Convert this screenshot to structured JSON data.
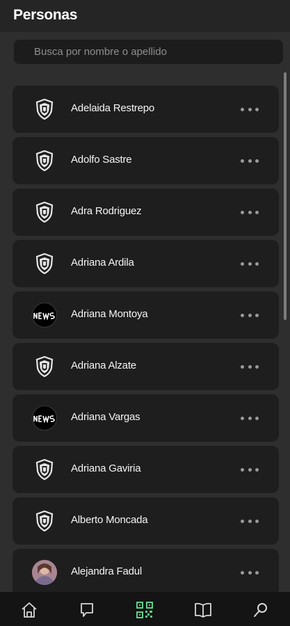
{
  "header": {
    "title": "Personas"
  },
  "search": {
    "placeholder": "Busca por nombre o apellido"
  },
  "people": [
    {
      "name": "Adelaida Restrepo",
      "avatar": "shield-logo"
    },
    {
      "name": "Adolfo Sastre",
      "avatar": "shield-logo"
    },
    {
      "name": "Adra Rodriguez",
      "avatar": "shield-logo"
    },
    {
      "name": "Adriana Ardila",
      "avatar": "shield-logo"
    },
    {
      "name": "Adriana Montoya",
      "avatar": "news-logo"
    },
    {
      "name": "Adriana Alzate",
      "avatar": "shield-logo"
    },
    {
      "name": "Adriana Vargas",
      "avatar": "news-logo"
    },
    {
      "name": "Adriana Gaviria",
      "avatar": "shield-logo"
    },
    {
      "name": "Alberto Moncada",
      "avatar": "shield-logo"
    },
    {
      "name": "Alejandra Fadul",
      "avatar": "photo"
    }
  ],
  "bottom_nav": [
    {
      "icon": "home-icon"
    },
    {
      "icon": "chat-icon"
    },
    {
      "icon": "qr-code-icon",
      "active": true
    },
    {
      "icon": "book-icon"
    },
    {
      "icon": "search-icon"
    }
  ],
  "colors": {
    "accent": "#5fd08a",
    "background": "#2e2e2e",
    "card": "#1e1e1e"
  }
}
